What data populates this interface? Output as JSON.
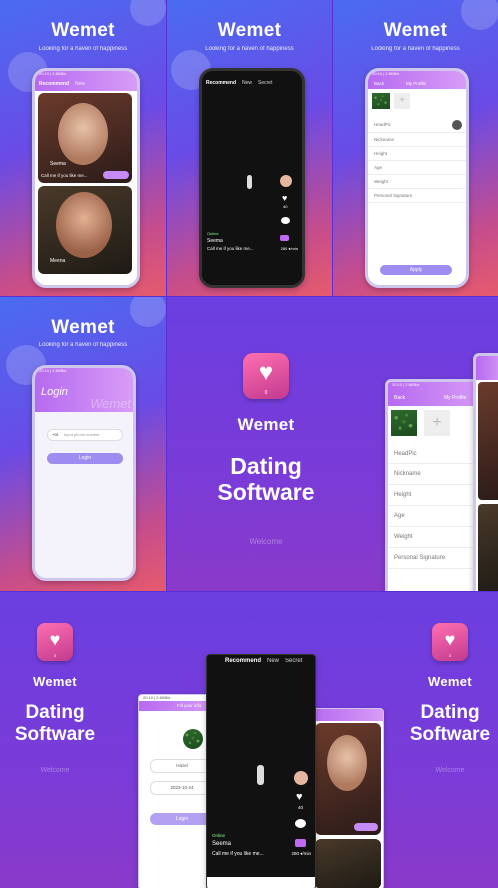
{
  "brand": "Wemet",
  "tagline": "Looking for a haven of happiness",
  "tabs": [
    "Recommend",
    "New",
    "Secret"
  ],
  "feed": [
    {
      "name": "Seema",
      "caption": "Call me if you like me..."
    },
    {
      "name": "Meena"
    }
  ],
  "video": {
    "name": "Seema",
    "caption": "Call me if you like me...",
    "likes": "40",
    "price": "280 ♦/min",
    "online": "Online"
  },
  "profile": {
    "back": "Back",
    "title": "My Profile",
    "rows": [
      "HeadPic",
      "Nickname",
      "Height",
      "Age",
      "Weight",
      "Personal Signature"
    ],
    "apply": "Apply"
  },
  "login": {
    "title": "Login",
    "watermark": "Wemet",
    "code": "+91",
    "placeholder": "Input phone number",
    "button": "Login"
  },
  "promo": {
    "title_line1": "Dating",
    "title_line2": "Software",
    "welcome": "Welcome",
    "logo_count": "0"
  },
  "register": {
    "header": "Fill your info",
    "name": "Hazel",
    "date": "2023-10-24",
    "button": "Login"
  },
  "statusbar": "20:10 | 2.6KB/s"
}
